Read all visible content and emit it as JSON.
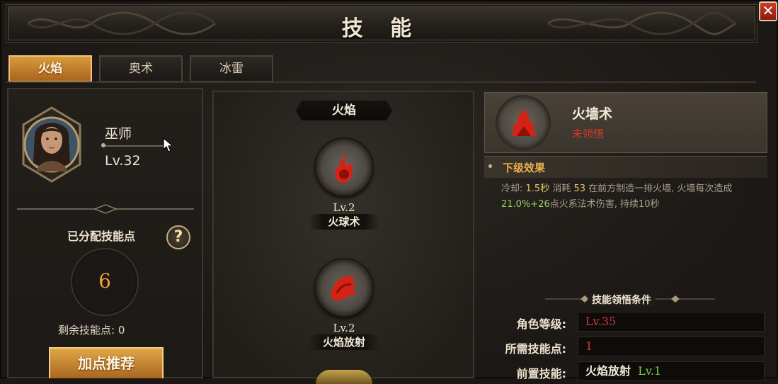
{
  "window": {
    "title": "技 能",
    "close_label": "✕"
  },
  "tabs": [
    {
      "label": "火焰",
      "active": true
    },
    {
      "label": "奥术",
      "active": false
    },
    {
      "label": "冰雷",
      "active": false
    }
  ],
  "character": {
    "class_name": "巫师",
    "level": "Lv.32"
  },
  "points": {
    "allocated_label": "已分配技能点",
    "allocated_value": "6",
    "help_label": "?",
    "remaining_label": "剩余技能点: 0",
    "recommend_button": "加点推荐"
  },
  "branch": {
    "title": "火焰",
    "skills": [
      {
        "level": "Lv.2",
        "name": "火球术",
        "icon": "fireball-icon"
      },
      {
        "level": "Lv.2",
        "name": "火焰放射",
        "icon": "flame-spray-icon"
      }
    ]
  },
  "detail": {
    "name": "火墙术",
    "status": "未领悟",
    "icon": "fire-wall-icon",
    "next_effect_title": "下级效果",
    "desc_part1": "冷却: ",
    "cooldown": "1.5秒",
    "desc_part2": " 消耗 ",
    "cost": "53",
    "desc_part3": " 在前方制造一排火墙, 火墙每次造成",
    "damage": "21.0%+26",
    "desc_part4": "点火系法术伤害, 持续10秒",
    "conditions_title": "技能领悟条件",
    "conditions": [
      {
        "label": "角色等级:",
        "value": "Lv.35"
      },
      {
        "label": "所需技能点:",
        "value": "1"
      },
      {
        "label": "前置技能:",
        "value": "火焰放射",
        "extra": "Lv.1"
      }
    ]
  },
  "colors": {
    "accent": "#d99a3c",
    "locked": "#d13a2a",
    "highlight": "#e9b04a"
  }
}
